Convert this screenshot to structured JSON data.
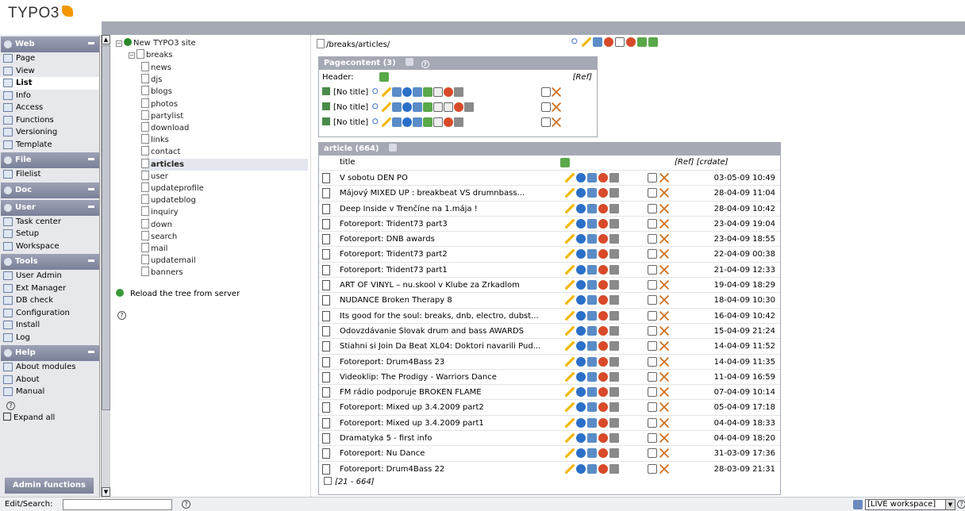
{
  "app": {
    "logo_text": "TYPO3"
  },
  "menu": {
    "groups": [
      {
        "label": "Web",
        "items": [
          "Page",
          "View",
          "List",
          "Info",
          "Access",
          "Functions",
          "Versioning",
          "Template"
        ],
        "selected": "List"
      },
      {
        "label": "File",
        "items": [
          "Filelist"
        ]
      },
      {
        "label": "Doc",
        "items": []
      },
      {
        "label": "User",
        "items": [
          "Task center",
          "Setup",
          "Workspace"
        ]
      },
      {
        "label": "Tools",
        "items": [
          "User Admin",
          "Ext Manager",
          "DB check",
          "Configuration",
          "Install",
          "Log"
        ]
      },
      {
        "label": "Help",
        "items": [
          "About modules",
          "About",
          "Manual"
        ]
      }
    ],
    "help_symbol": "?",
    "expand_all": "Expand all",
    "admin_functions": "Admin functions"
  },
  "tree": {
    "root": "New TYPO3 site",
    "parent": "breaks",
    "pages": [
      "news",
      "djs",
      "blogs",
      "photos",
      "partylist",
      "download",
      "links",
      "contact",
      "articles",
      "user",
      "updateprofile",
      "updateblog",
      "inquiry",
      "down",
      "search",
      "mail",
      "updatemail",
      "banners"
    ],
    "selected": "articles",
    "reload": "Reload the tree from server",
    "help_symbol": "?"
  },
  "main": {
    "path": "/breaks/articles/",
    "pagecontent": {
      "title": "Pagecontent (3)",
      "header_label": "Header:",
      "ref": "[Ref]",
      "rows": [
        "[No title]",
        "[No title]",
        "[No title]"
      ]
    },
    "articles": {
      "title": "article (664)",
      "col_title": "title",
      "col_ref": "[Ref]",
      "col_crdate": "[crdate]",
      "rows": [
        {
          "title": "V sobotu DEN PO",
          "date": "03-05-09 10:49"
        },
        {
          "title": "Májový MIXED UP : breakbeat VS drumnbass...",
          "date": "28-04-09 11:04"
        },
        {
          "title": "Deep Inside v Trenčíne na 1.mája !",
          "date": "28-04-09 10:42"
        },
        {
          "title": "Fotoreport: Trident73 part3",
          "date": "23-04-09 19:04"
        },
        {
          "title": "Fotoreport: DNB awards",
          "date": "23-04-09 18:55"
        },
        {
          "title": "Fotoreport: Trident73 part2",
          "date": "22-04-09 00:38"
        },
        {
          "title": "Fotoreport: Trident73 part1",
          "date": "21-04-09 12:33"
        },
        {
          "title": "ART OF VINYL – nu.skool v Klube za Zrkadlom",
          "date": "19-04-09 18:29"
        },
        {
          "title": "NUDANCE Broken Therapy 8",
          "date": "18-04-09 10:30"
        },
        {
          "title": "Its good for the soul: breaks, dnb, electro, dubst...",
          "date": "16-04-09 10:42"
        },
        {
          "title": "Odovzdávanie Slovak drum and bass AWARDS",
          "date": "15-04-09 21:24"
        },
        {
          "title": "Stiahni si Join Da Beat XL04: Doktori navarili Pud...",
          "date": "14-04-09 11:52"
        },
        {
          "title": "Fotoreport: Drum4Bass 23",
          "date": "14-04-09 11:35"
        },
        {
          "title": "Videoklip: The Prodigy - Warriors Dance",
          "date": "11-04-09 16:59"
        },
        {
          "title": "FM rádio podporuje BROKEN FLAME",
          "date": "07-04-09 10:14"
        },
        {
          "title": "Fotoreport: Mixed up 3.4.2009 part2",
          "date": "05-04-09 17:18"
        },
        {
          "title": "Fotoreport: Mixed up 3.4.2009 part1",
          "date": "04-04-09 18:33"
        },
        {
          "title": "Dramatyka 5 - first info",
          "date": "04-04-09 18:20"
        },
        {
          "title": "Fotoreport: Nu Dance",
          "date": "31-03-09 17:36"
        },
        {
          "title": "Fotoreport: Drum4Bass 22",
          "date": "28-03-09 21:31"
        }
      ],
      "more": "[21 - 664]"
    }
  },
  "bottom": {
    "search_label": "Edit/Search:",
    "search_value": "",
    "help_symbol": "?",
    "workspace": "[LIVE workspace]"
  }
}
